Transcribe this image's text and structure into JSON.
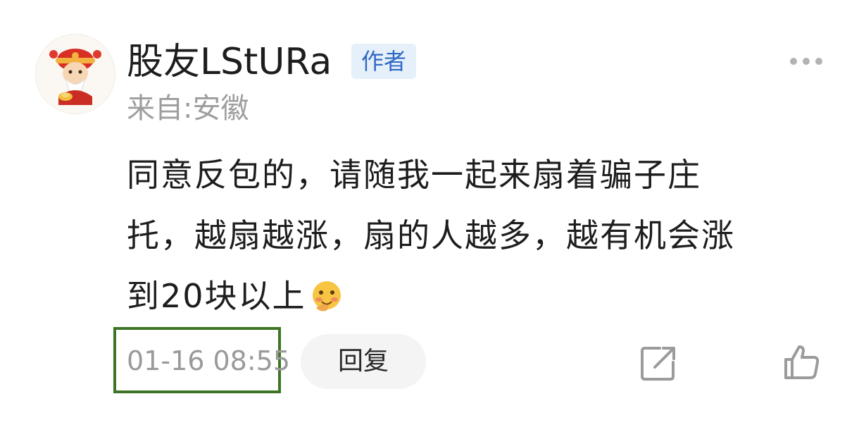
{
  "comment": {
    "username": "股友LStURa",
    "author_badge": "作者",
    "location": "来自:安徽",
    "body_lines": [
      "同意反包的，请随我一起来扇着骗子庄",
      "托，越扇越涨，扇的人越多，越有机会涨",
      "到20块以上"
    ],
    "emoji": "face-with-hand-over-mouth-emoji",
    "timestamp": "01-16 08:55",
    "reply_label": "回复",
    "icons": {
      "avatar": "cartoon-avatar",
      "more": "more-dots-icon",
      "share": "share-icon",
      "like": "thumbs-up-icon"
    }
  },
  "colors": {
    "badge_background": "#e6f0fb",
    "badge_text": "#2f69c4",
    "muted_text": "#9d9d9d",
    "highlight_border": "#3d7524",
    "reply_background": "#f4f4f4"
  }
}
